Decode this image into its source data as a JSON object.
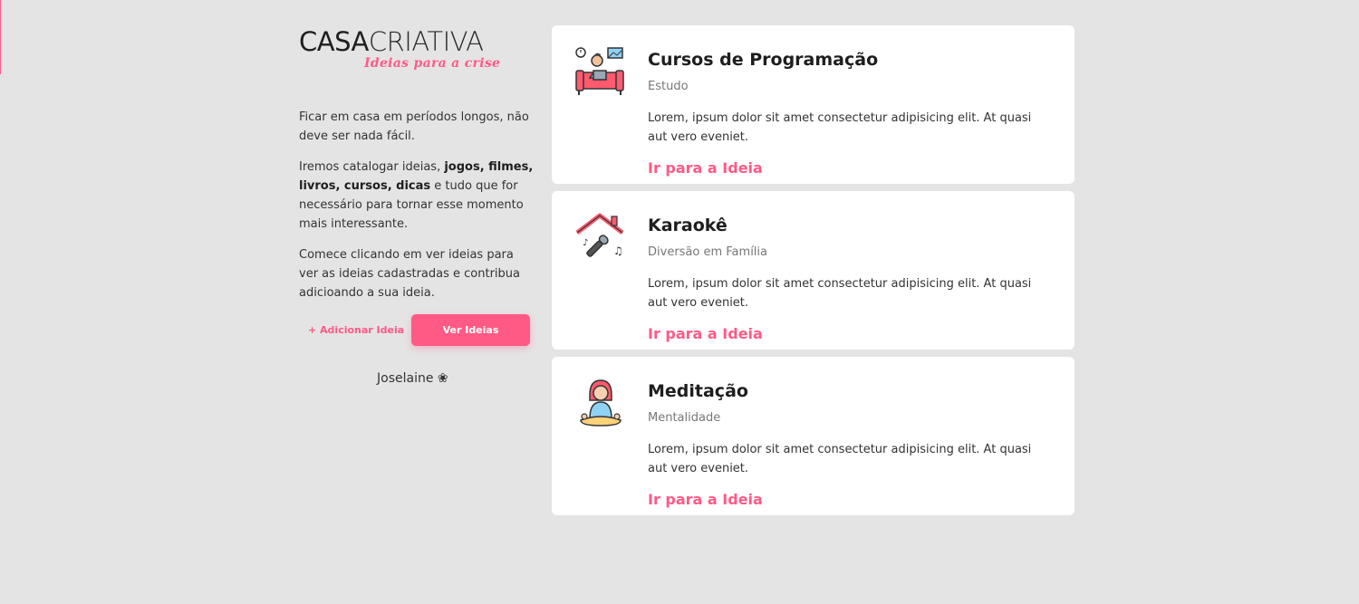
{
  "brand": {
    "name_part1": "CASA",
    "name_part2": "CRIATIVA",
    "tagline": "Ideias para a crise",
    "accent_color": "#ff5a85"
  },
  "intro": {
    "p1": "Ficar em casa em períodos longos, não deve ser nada fácil.",
    "p2_start": "Iremos catalogar ideias, ",
    "p2_bold": "jogos, filmes, livros, cursos, dicas",
    "p2_end": " e tudo que for necessário para tornar esse momento mais interessante.",
    "p3": "Comece clicando em ver ideias para ver as ideias cadastradas e contribua adicioando a sua ideia."
  },
  "actions": {
    "add_label": "+ Adicionar Ideia",
    "see_label": "Ver Ideias"
  },
  "author": "Joselaine ❀",
  "ideas": [
    {
      "icon": "programming-study-icon",
      "title": "Cursos de Programação",
      "category": "Estudo",
      "description": "Lorem, ipsum dolor sit amet consectetur adipisicing elit. At quasi aut vero eveniet.",
      "link": "Ir para a Ideia"
    },
    {
      "icon": "karaoke-icon",
      "title": "Karaokê",
      "category": "Diversão em Família",
      "description": "Lorem, ipsum dolor sit amet consectetur adipisicing elit. At quasi aut vero eveniet.",
      "link": "Ir para a Ideia"
    },
    {
      "icon": "meditation-icon",
      "title": "Meditação",
      "category": "Mentalidade",
      "description": "Lorem, ipsum dolor sit amet consectetur adipisicing elit. At quasi aut vero eveniet.",
      "link": "Ir para a Ideia"
    }
  ]
}
